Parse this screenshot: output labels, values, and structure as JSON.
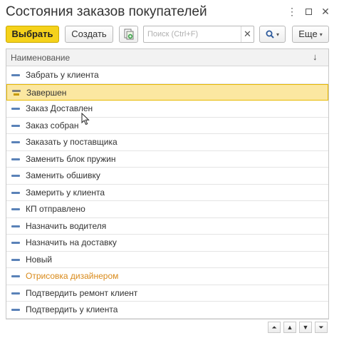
{
  "window": {
    "title": "Состояния заказов покупателей",
    "more_glyph": "⋮",
    "close_glyph": "✕"
  },
  "toolbar": {
    "select_label": "Выбрать",
    "create_label": "Создать",
    "copy_icon": "copy-add-icon",
    "search_placeholder": "Поиск (Ctrl+F)",
    "search_value": "",
    "clear_glyph": "✕",
    "find_glyph": "🔍",
    "more_label": "Еще",
    "chevron_glyph": "▾"
  },
  "table": {
    "column_header": "Наименование",
    "sort_glyph": "↓",
    "rows": [
      {
        "label": "Забрать у клиента",
        "selected": false,
        "highlight": false
      },
      {
        "label": "Завершен",
        "selected": true,
        "highlight": false
      },
      {
        "label": "Заказ Доставлен",
        "selected": false,
        "highlight": false
      },
      {
        "label": "Заказ собран",
        "selected": false,
        "highlight": false
      },
      {
        "label": "Заказать у поставщика",
        "selected": false,
        "highlight": false
      },
      {
        "label": "Заменить блок пружин",
        "selected": false,
        "highlight": false
      },
      {
        "label": "Заменить обшивку",
        "selected": false,
        "highlight": false
      },
      {
        "label": "Замерить у клиента",
        "selected": false,
        "highlight": false
      },
      {
        "label": "КП отправлено",
        "selected": false,
        "highlight": false
      },
      {
        "label": "Назначить водителя",
        "selected": false,
        "highlight": false
      },
      {
        "label": "Назначить на доставку",
        "selected": false,
        "highlight": false
      },
      {
        "label": "Новый",
        "selected": false,
        "highlight": false
      },
      {
        "label": "Отрисовка дизайнером",
        "selected": false,
        "highlight": true
      },
      {
        "label": "Подтвердить ремонт клиент",
        "selected": false,
        "highlight": false
      },
      {
        "label": "Подтвердить у клиента",
        "selected": false,
        "highlight": false
      }
    ]
  },
  "nav": {
    "first_glyph": "⏶",
    "up_glyph": "▲",
    "down_glyph": "▼",
    "last_glyph": "⏷"
  },
  "colors": {
    "accent_yellow": "#f5d21b",
    "selected_row": "#fbe7a1",
    "highlight_text": "#d98a1a",
    "row_icon": "#5a82b8"
  }
}
